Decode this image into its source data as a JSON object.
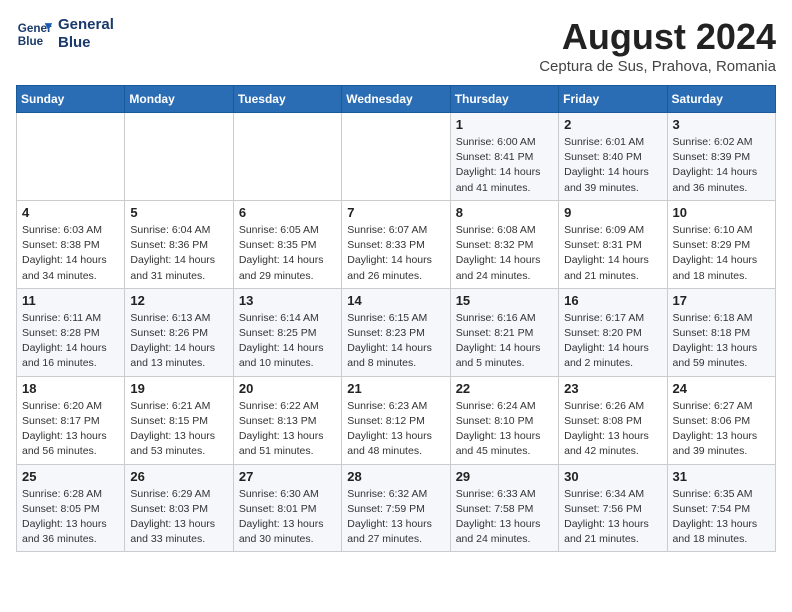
{
  "header": {
    "logo_line1": "General",
    "logo_line2": "Blue",
    "month_title": "August 2024",
    "location": "Ceptura de Sus, Prahova, Romania"
  },
  "weekdays": [
    "Sunday",
    "Monday",
    "Tuesday",
    "Wednesday",
    "Thursday",
    "Friday",
    "Saturday"
  ],
  "weeks": [
    [
      {
        "day": "",
        "info": ""
      },
      {
        "day": "",
        "info": ""
      },
      {
        "day": "",
        "info": ""
      },
      {
        "day": "",
        "info": ""
      },
      {
        "day": "1",
        "info": "Sunrise: 6:00 AM\nSunset: 8:41 PM\nDaylight: 14 hours\nand 41 minutes."
      },
      {
        "day": "2",
        "info": "Sunrise: 6:01 AM\nSunset: 8:40 PM\nDaylight: 14 hours\nand 39 minutes."
      },
      {
        "day": "3",
        "info": "Sunrise: 6:02 AM\nSunset: 8:39 PM\nDaylight: 14 hours\nand 36 minutes."
      }
    ],
    [
      {
        "day": "4",
        "info": "Sunrise: 6:03 AM\nSunset: 8:38 PM\nDaylight: 14 hours\nand 34 minutes."
      },
      {
        "day": "5",
        "info": "Sunrise: 6:04 AM\nSunset: 8:36 PM\nDaylight: 14 hours\nand 31 minutes."
      },
      {
        "day": "6",
        "info": "Sunrise: 6:05 AM\nSunset: 8:35 PM\nDaylight: 14 hours\nand 29 minutes."
      },
      {
        "day": "7",
        "info": "Sunrise: 6:07 AM\nSunset: 8:33 PM\nDaylight: 14 hours\nand 26 minutes."
      },
      {
        "day": "8",
        "info": "Sunrise: 6:08 AM\nSunset: 8:32 PM\nDaylight: 14 hours\nand 24 minutes."
      },
      {
        "day": "9",
        "info": "Sunrise: 6:09 AM\nSunset: 8:31 PM\nDaylight: 14 hours\nand 21 minutes."
      },
      {
        "day": "10",
        "info": "Sunrise: 6:10 AM\nSunset: 8:29 PM\nDaylight: 14 hours\nand 18 minutes."
      }
    ],
    [
      {
        "day": "11",
        "info": "Sunrise: 6:11 AM\nSunset: 8:28 PM\nDaylight: 14 hours\nand 16 minutes."
      },
      {
        "day": "12",
        "info": "Sunrise: 6:13 AM\nSunset: 8:26 PM\nDaylight: 14 hours\nand 13 minutes."
      },
      {
        "day": "13",
        "info": "Sunrise: 6:14 AM\nSunset: 8:25 PM\nDaylight: 14 hours\nand 10 minutes."
      },
      {
        "day": "14",
        "info": "Sunrise: 6:15 AM\nSunset: 8:23 PM\nDaylight: 14 hours\nand 8 minutes."
      },
      {
        "day": "15",
        "info": "Sunrise: 6:16 AM\nSunset: 8:21 PM\nDaylight: 14 hours\nand 5 minutes."
      },
      {
        "day": "16",
        "info": "Sunrise: 6:17 AM\nSunset: 8:20 PM\nDaylight: 14 hours\nand 2 minutes."
      },
      {
        "day": "17",
        "info": "Sunrise: 6:18 AM\nSunset: 8:18 PM\nDaylight: 13 hours\nand 59 minutes."
      }
    ],
    [
      {
        "day": "18",
        "info": "Sunrise: 6:20 AM\nSunset: 8:17 PM\nDaylight: 13 hours\nand 56 minutes."
      },
      {
        "day": "19",
        "info": "Sunrise: 6:21 AM\nSunset: 8:15 PM\nDaylight: 13 hours\nand 53 minutes."
      },
      {
        "day": "20",
        "info": "Sunrise: 6:22 AM\nSunset: 8:13 PM\nDaylight: 13 hours\nand 51 minutes."
      },
      {
        "day": "21",
        "info": "Sunrise: 6:23 AM\nSunset: 8:12 PM\nDaylight: 13 hours\nand 48 minutes."
      },
      {
        "day": "22",
        "info": "Sunrise: 6:24 AM\nSunset: 8:10 PM\nDaylight: 13 hours\nand 45 minutes."
      },
      {
        "day": "23",
        "info": "Sunrise: 6:26 AM\nSunset: 8:08 PM\nDaylight: 13 hours\nand 42 minutes."
      },
      {
        "day": "24",
        "info": "Sunrise: 6:27 AM\nSunset: 8:06 PM\nDaylight: 13 hours\nand 39 minutes."
      }
    ],
    [
      {
        "day": "25",
        "info": "Sunrise: 6:28 AM\nSunset: 8:05 PM\nDaylight: 13 hours\nand 36 minutes."
      },
      {
        "day": "26",
        "info": "Sunrise: 6:29 AM\nSunset: 8:03 PM\nDaylight: 13 hours\nand 33 minutes."
      },
      {
        "day": "27",
        "info": "Sunrise: 6:30 AM\nSunset: 8:01 PM\nDaylight: 13 hours\nand 30 minutes."
      },
      {
        "day": "28",
        "info": "Sunrise: 6:32 AM\nSunset: 7:59 PM\nDaylight: 13 hours\nand 27 minutes."
      },
      {
        "day": "29",
        "info": "Sunrise: 6:33 AM\nSunset: 7:58 PM\nDaylight: 13 hours\nand 24 minutes."
      },
      {
        "day": "30",
        "info": "Sunrise: 6:34 AM\nSunset: 7:56 PM\nDaylight: 13 hours\nand 21 minutes."
      },
      {
        "day": "31",
        "info": "Sunrise: 6:35 AM\nSunset: 7:54 PM\nDaylight: 13 hours\nand 18 minutes."
      }
    ]
  ]
}
